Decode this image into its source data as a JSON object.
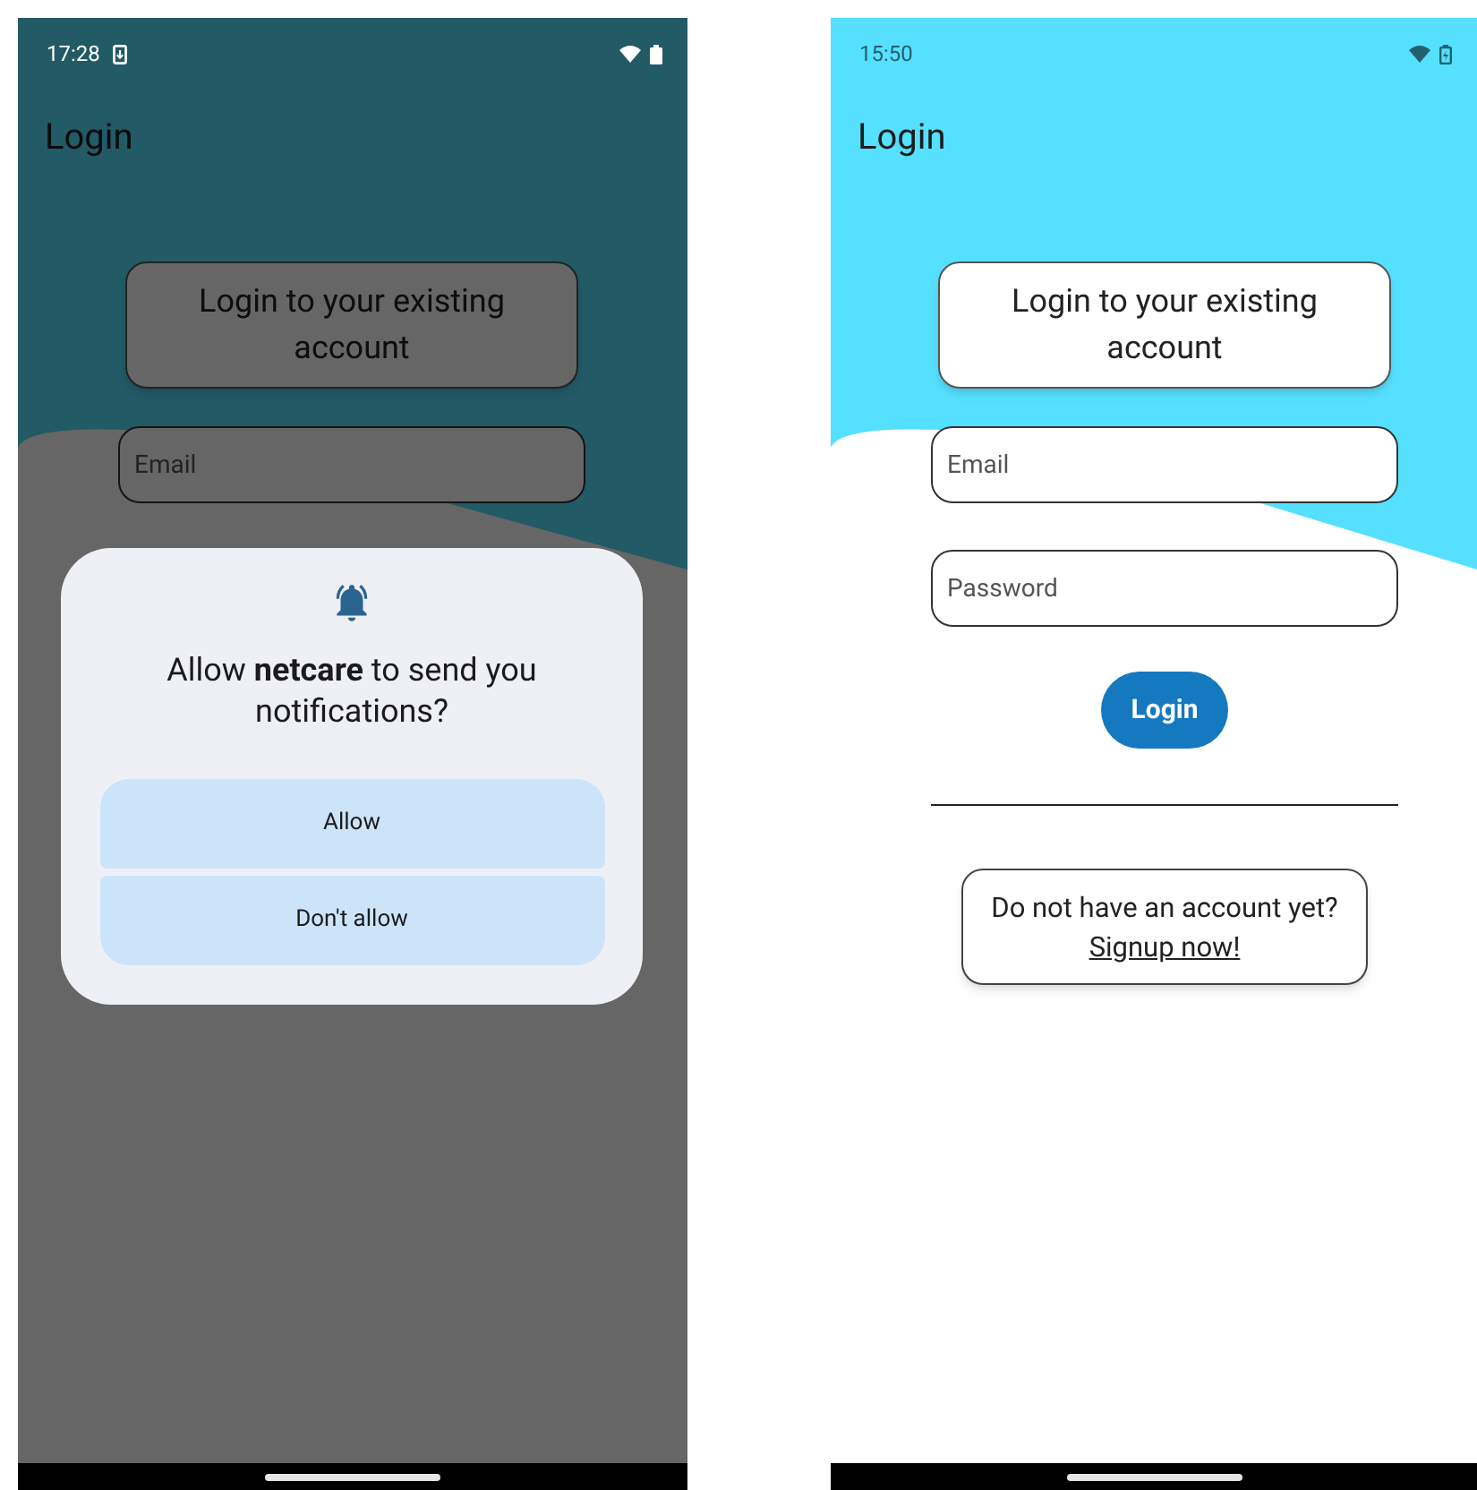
{
  "screens": [
    {
      "status_bar": {
        "time": "17:28",
        "light_icons": true,
        "download_notification": true,
        "charging": false
      },
      "app_bar": {
        "title": "Login"
      },
      "header_card": "Login to your existing account",
      "fields": [
        {
          "placeholder": "Email"
        }
      ],
      "dimmed": true,
      "dialog": {
        "message": "Allow **netcare** to send you notifications?",
        "buttons": [
          "Allow",
          "Don't allow"
        ]
      }
    },
    {
      "status_bar": {
        "time": "15:50",
        "light_icons": false,
        "download_notification": false,
        "charging": true
      },
      "app_bar": {
        "title": "Login"
      },
      "header_card": "Login to your existing account",
      "fields": [
        {
          "placeholder": "Email"
        },
        {
          "placeholder": "Password"
        }
      ],
      "dimmed": false,
      "login_button": "Login",
      "signup_card": {
        "prompt": "Do not have an account yet?",
        "link": "Signup now!"
      }
    }
  ]
}
